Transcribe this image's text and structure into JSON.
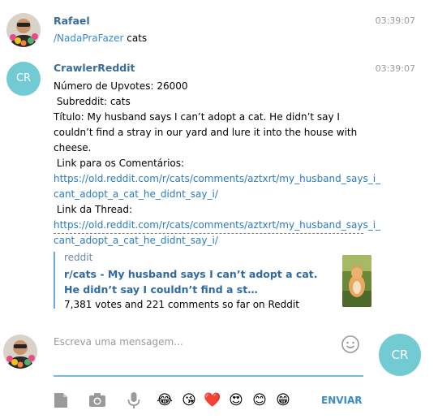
{
  "messages": [
    {
      "author": "Rafael",
      "time": "03:39:07",
      "command": "/NadaPraFazer",
      "command_arg": " cats"
    },
    {
      "author": "CrawlerReddit",
      "avatar_initials": "CR",
      "time": "03:39:07",
      "upvotes_line": "Número de Upvotes: 26000",
      "subreddit_line": " Subreddit: cats",
      "title_line": " Título: My husband says I can’t adopt a cat. He didn’t say I couldn’t find a stray in our yard and lure it into the house with cheese.",
      "comments_label": " Link para os Comentários:",
      "comments_link_1": "https://old.reddit.com/r/cats/comments/aztxrt/my_husband_says_i_",
      "comments_link_2": "cant_adopt_a_cat_he_didnt_say_i/",
      "thread_label": " Link da Thread:",
      "thread_link_1": "https://old.reddit.com/r/cats/comments/aztxrt/my_husband_says_i_",
      "thread_link_2": "cant_adopt_a_cat_he_didnt_say_i/",
      "preview": {
        "site": "reddit",
        "title": "r/cats - My husband says I can’t adopt a cat. He didn’t say I couldn’t find a st…",
        "description": "7,381 votes and 221 comments so far on Reddit"
      }
    }
  ],
  "composer": {
    "placeholder": "Escreva uma mensagem...",
    "bot_initials": "CR",
    "send_label": "ENVIAR"
  },
  "toolbar": {
    "icons": [
      "document-icon",
      "camera-icon",
      "microphone-icon"
    ],
    "emojis": [
      "😂",
      "😘",
      "❤️",
      "😍",
      "😊",
      "😁"
    ]
  },
  "colors": {
    "author": "#3a6d99",
    "link": "#2a7bc0",
    "avatar_cr": "#72cbd3",
    "input_underline": "#76b9d8",
    "send": "#3a8bc8"
  }
}
